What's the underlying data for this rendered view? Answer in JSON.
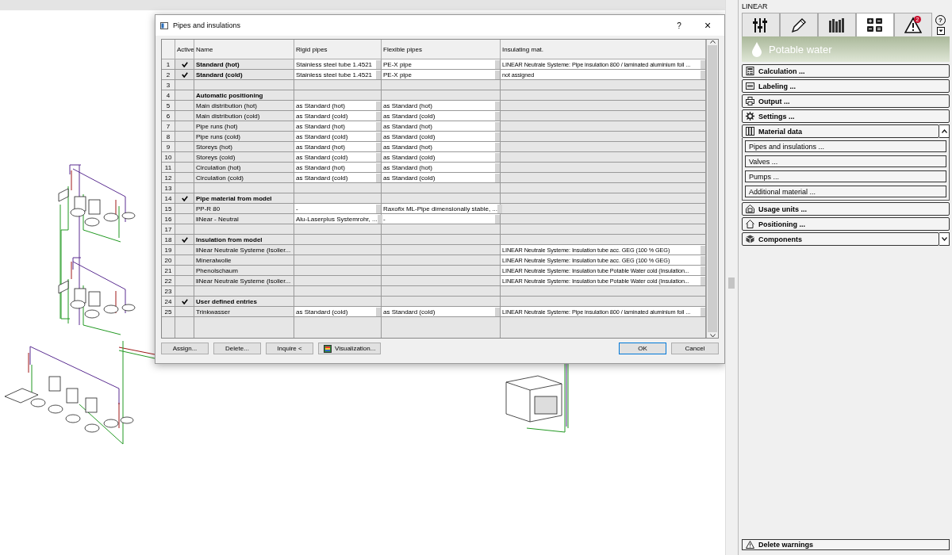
{
  "dialog": {
    "title": "Pipes and insulations",
    "help": "?",
    "close": "×",
    "active_header": "Active",
    "columns": [
      "Name",
      "Rigid pipes",
      "Flexible pipes",
      "Insulating mat."
    ],
    "rows": [
      {
        "number": "1",
        "active": true,
        "kind": "heading",
        "cells": [
          {
            "text": "Standard (hot)",
            "editable": false
          },
          {
            "text": "Stainless steel tube 1.4521",
            "editable": true
          },
          {
            "text": "PE-X pipe",
            "editable": true
          },
          {
            "text": "LINEAR Neutrale Systeme: Pipe insulation 800 / laminated aluminium foil ...",
            "editable": true
          }
        ]
      },
      {
        "number": "2",
        "active": true,
        "kind": "heading",
        "cells": [
          {
            "text": "Standard (cold)",
            "editable": false
          },
          {
            "text": "Stainless steel tube 1.4521",
            "editable": true
          },
          {
            "text": "PE-X pipe",
            "editable": true
          },
          {
            "text": "not assigned",
            "editable": true
          }
        ]
      },
      {
        "number": "3",
        "active": false,
        "kind": "entry",
        "cells": [
          {
            "editable": false
          },
          {
            "editable": false
          },
          {
            "editable": false
          },
          {
            "editable": false
          }
        ]
      },
      {
        "number": "4",
        "active": false,
        "kind": "heading",
        "cells": [
          {
            "text": "Automatic positioning",
            "editable": false
          },
          {
            "editable": false
          },
          {
            "editable": false
          },
          {
            "editable": false
          }
        ]
      },
      {
        "number": "5",
        "active": false,
        "kind": "entry",
        "cells": [
          {
            "text": "Main distribution (hot)",
            "editable": false
          },
          {
            "text": "as Standard (hot)",
            "editable": true
          },
          {
            "text": "as Standard (hot)",
            "editable": true
          },
          {
            "editable": false
          }
        ]
      },
      {
        "number": "6",
        "active": false,
        "kind": "entry",
        "cells": [
          {
            "text": "Main distribution (cold)",
            "editable": false
          },
          {
            "text": "as Standard (cold)",
            "editable": true
          },
          {
            "text": "as Standard (cold)",
            "editable": true
          },
          {
            "editable": false
          }
        ]
      },
      {
        "number": "7",
        "active": false,
        "kind": "entry",
        "cells": [
          {
            "text": "Pipe runs (hot)",
            "editable": false
          },
          {
            "text": "as Standard (hot)",
            "editable": true
          },
          {
            "text": "as Standard (hot)",
            "editable": true
          },
          {
            "editable": false
          }
        ]
      },
      {
        "number": "8",
        "active": false,
        "kind": "entry",
        "cells": [
          {
            "text": "Pipe runs (cold)",
            "editable": false
          },
          {
            "text": "as Standard (cold)",
            "editable": true
          },
          {
            "text": "as Standard (cold)",
            "editable": true
          },
          {
            "editable": false
          }
        ]
      },
      {
        "number": "9",
        "active": false,
        "kind": "entry",
        "cells": [
          {
            "text": "Storeys (hot)",
            "editable": false
          },
          {
            "text": "as Standard (hot)",
            "editable": true
          },
          {
            "text": "as Standard (hot)",
            "editable": true
          },
          {
            "editable": false
          }
        ]
      },
      {
        "number": "10",
        "active": false,
        "kind": "entry",
        "cells": [
          {
            "text": "Storeys (cold)",
            "editable": false
          },
          {
            "text": "as Standard (cold)",
            "editable": true
          },
          {
            "text": "as Standard (cold)",
            "editable": true
          },
          {
            "editable": false
          }
        ]
      },
      {
        "number": "11",
        "active": false,
        "kind": "entry",
        "cells": [
          {
            "text": "Circulation (hot)",
            "editable": false
          },
          {
            "text": "as Standard (hot)",
            "editable": true
          },
          {
            "text": "as Standard (hot)",
            "editable": true
          },
          {
            "editable": false
          }
        ]
      },
      {
        "number": "12",
        "active": false,
        "kind": "entry",
        "cells": [
          {
            "text": "Circulation (cold)",
            "editable": false
          },
          {
            "text": "as Standard (cold)",
            "editable": true
          },
          {
            "text": "as Standard (cold)",
            "editable": true
          },
          {
            "editable": false
          }
        ]
      },
      {
        "number": "13",
        "active": false,
        "kind": "entry",
        "cells": [
          {
            "editable": false
          },
          {
            "editable": false
          },
          {
            "editable": false
          },
          {
            "editable": false
          }
        ]
      },
      {
        "number": "14",
        "active": true,
        "kind": "heading",
        "cells": [
          {
            "text": "Pipe material from model",
            "editable": false
          },
          {
            "editable": false
          },
          {
            "editable": false
          },
          {
            "editable": false
          }
        ]
      },
      {
        "number": "15",
        "active": false,
        "kind": "entry",
        "cells": [
          {
            "text": "PP-R 80",
            "editable": false
          },
          {
            "text": "-",
            "editable": true
          },
          {
            "text": "Raxofix ML-Pipe dimensionally stable, ...",
            "editable": true
          },
          {
            "editable": false
          }
        ]
      },
      {
        "number": "16",
        "active": false,
        "kind": "entry",
        "cells": [
          {
            "text": "liNear - Neutral",
            "editable": false
          },
          {
            "text": "Alu-Laserplus Systemrohr, ...",
            "editable": true
          },
          {
            "text": "-",
            "editable": true
          },
          {
            "editable": false
          }
        ]
      },
      {
        "number": "17",
        "active": false,
        "kind": "entry",
        "cells": [
          {
            "editable": false
          },
          {
            "editable": false
          },
          {
            "editable": false
          },
          {
            "editable": false
          }
        ]
      },
      {
        "number": "18",
        "active": true,
        "kind": "heading",
        "cells": [
          {
            "text": "Insulation from model",
            "editable": false
          },
          {
            "editable": false
          },
          {
            "editable": false
          },
          {
            "editable": false
          }
        ]
      },
      {
        "number": "19",
        "active": false,
        "kind": "entry",
        "cells": [
          {
            "text": "liNear Neutrale Systeme (Isolier...",
            "editable": false
          },
          {
            "editable": false
          },
          {
            "editable": false
          },
          {
            "text": "LINEAR Neutrale Systeme: Insulation tube acc. GEG (100 % GEG)",
            "editable": true
          }
        ]
      },
      {
        "number": "20",
        "active": false,
        "kind": "entry",
        "cells": [
          {
            "text": "Mineralwolle",
            "editable": false
          },
          {
            "editable": false
          },
          {
            "editable": false
          },
          {
            "text": "LINEAR Neutrale Systeme: Insulation tube acc. GEG (100 % GEG)",
            "editable": true
          }
        ]
      },
      {
        "number": "21",
        "active": false,
        "kind": "entry",
        "cells": [
          {
            "text": "Phenolschaum",
            "editable": false
          },
          {
            "editable": false
          },
          {
            "editable": false
          },
          {
            "text": "LINEAR Neutrale Systeme: Insulation tube Potable Water cold (Insulation...",
            "editable": true
          }
        ]
      },
      {
        "number": "22",
        "active": false,
        "kind": "entry",
        "cells": [
          {
            "text": "liNear Neutrale Systeme (Isolier...",
            "editable": false
          },
          {
            "editable": false
          },
          {
            "editable": false
          },
          {
            "text": "LINEAR Neutrale Systeme: Insulation tube Potable Water cold (Insulation...",
            "editable": true
          }
        ]
      },
      {
        "number": "23",
        "active": false,
        "kind": "entry",
        "cells": [
          {
            "editable": false
          },
          {
            "editable": false
          },
          {
            "editable": false
          },
          {
            "editable": false
          }
        ]
      },
      {
        "number": "24",
        "active": true,
        "kind": "heading",
        "cells": [
          {
            "text": "User defined entries",
            "editable": false
          },
          {
            "editable": false
          },
          {
            "editable": false
          },
          {
            "editable": false
          }
        ]
      },
      {
        "number": "25",
        "active": false,
        "kind": "entry",
        "cells": [
          {
            "text": "Trinkwasser",
            "editable": false
          },
          {
            "text": "as Standard (cold)",
            "editable": true
          },
          {
            "text": "as Standard (cold)",
            "editable": true
          },
          {
            "text": "LINEAR Neutrale Systeme: Pipe insulation 800 / laminated aluminium foil ...",
            "editable": true
          }
        ]
      }
    ],
    "buttons": [
      {
        "label": "Assign...",
        "kind": "plain"
      },
      {
        "label": "Delete...",
        "kind": "plain"
      },
      {
        "label": "Inquire <",
        "kind": "plain"
      },
      {
        "label": "Visualization...",
        "kind": "icon"
      },
      {
        "label": "OK",
        "kind": "default"
      },
      {
        "label": "Cancel",
        "kind": "plain"
      }
    ]
  },
  "panel": {
    "title": "LINEAR",
    "tabs": [
      {
        "kind": "sliders",
        "selected": false
      },
      {
        "kind": "pencil",
        "selected": false
      },
      {
        "kind": "books",
        "selected": false
      },
      {
        "kind": "grid",
        "selected": true
      },
      {
        "kind": "warning",
        "selected": false,
        "badge": "2"
      }
    ],
    "help": "?",
    "header": "Potable water",
    "sections": [
      {
        "label": "Calculation ...",
        "kind": "calculator"
      },
      {
        "label": "Labeling ...",
        "kind": "label"
      },
      {
        "label": "Output ...",
        "kind": "printer"
      },
      {
        "label": "Settings ...",
        "kind": "gear"
      },
      {
        "label": "Material data",
        "kind": "books",
        "expanded": true,
        "children": [
          "Pipes and insulations ...",
          "Valves ...",
          "Pumps ...",
          "Additional material ..."
        ]
      },
      {
        "label": "Usage units ...",
        "kind": "building"
      },
      {
        "label": "Positioning ...",
        "kind": "house"
      },
      {
        "label": "Components",
        "kind": "cube",
        "expanded": false
      }
    ],
    "footer": "Delete warnings"
  }
}
